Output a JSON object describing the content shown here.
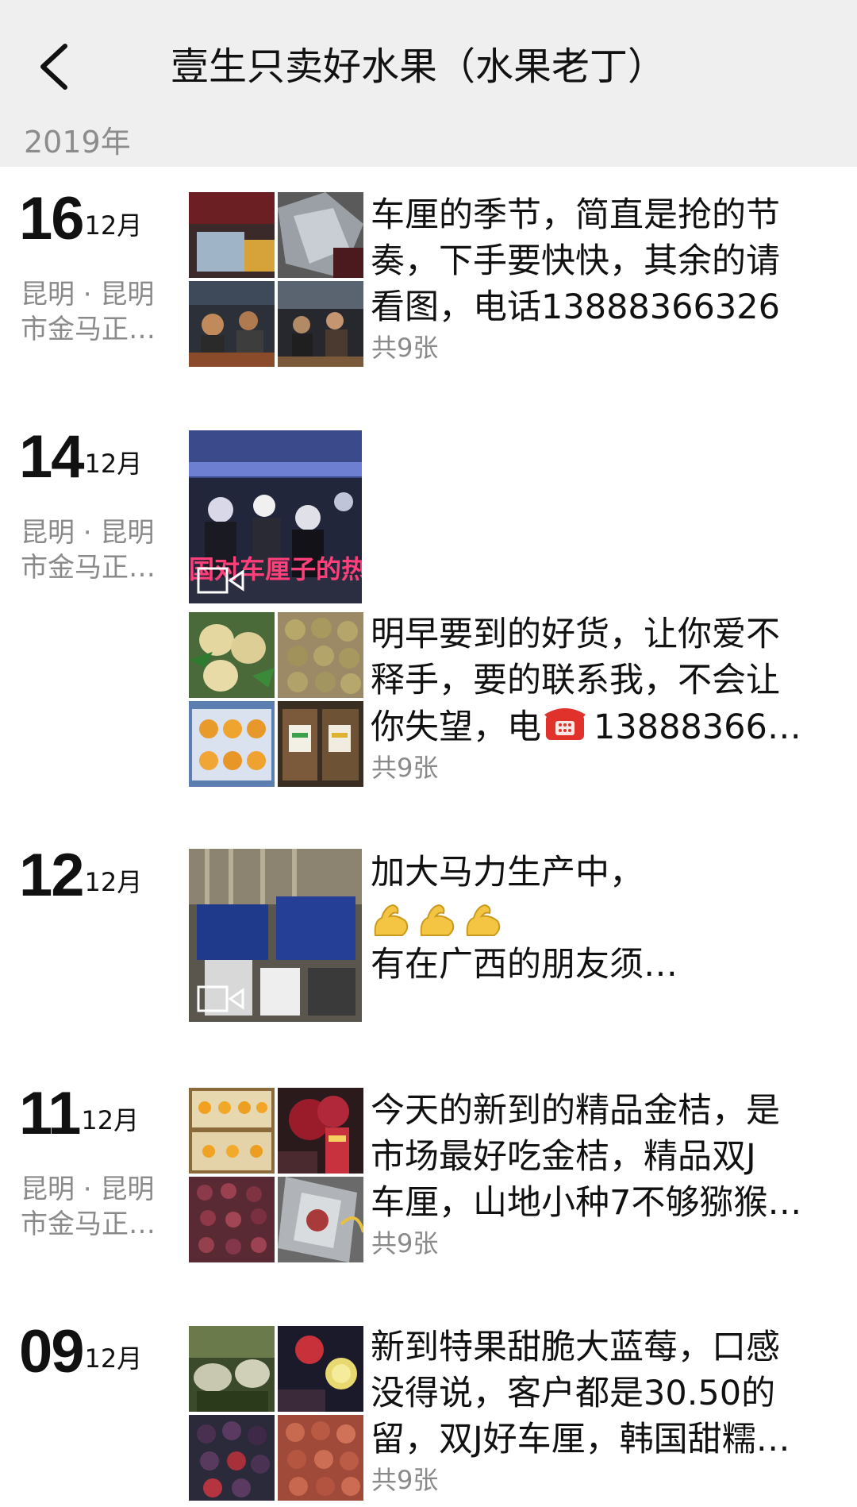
{
  "nav": {
    "title": "壹生只卖好水果（水果老丁）",
    "back_icon": "chevron-left-icon"
  },
  "year_label": "2019年",
  "posts": [
    {
      "day": "16",
      "month": "12月",
      "location_line1": "昆明 · 昆明",
      "location_line2": "市金马正…",
      "text_lines": [
        "车厘的季节，简直是抢的节",
        "奏，下手要快快，其余的请",
        "看图，电话13888366326"
      ],
      "count": "共9张"
    },
    {
      "day": "14",
      "month": "12月",
      "location_line1": "昆明 · 昆明",
      "location_line2": "市金马正…",
      "video_overlay": "国对车厘子的热",
      "text_lines": [
        "明早要到的好货，让你爱不",
        "释手，要的联系我，不会让",
        "你失望，电",
        "13888366…"
      ],
      "count": "共9张"
    },
    {
      "day": "12",
      "month": "12月",
      "text_lines": [
        "加大马力生产中，",
        "有在广西的朋友须…"
      ]
    },
    {
      "day": "11",
      "month": "12月",
      "location_line1": "昆明 · 昆明",
      "location_line2": "市金马正…",
      "text_lines": [
        "今天的新到的精品金桔，是",
        "市场最好吃金桔，精品双J",
        "车厘，山地小种7不够猕猴…"
      ],
      "count": "共9张"
    },
    {
      "day": "09",
      "month": "12月",
      "text_lines": [
        "新到特果甜脆大蓝莓，口感",
        "没得说，客户都是30.50的",
        "留，双J好车厘，韩国甜糯…"
      ],
      "count": "共9张"
    }
  ],
  "colors": {
    "nav_bg": "#efefef",
    "muted_text": "#8a8a8a",
    "video_overlay_text": "#ff3f7a"
  }
}
